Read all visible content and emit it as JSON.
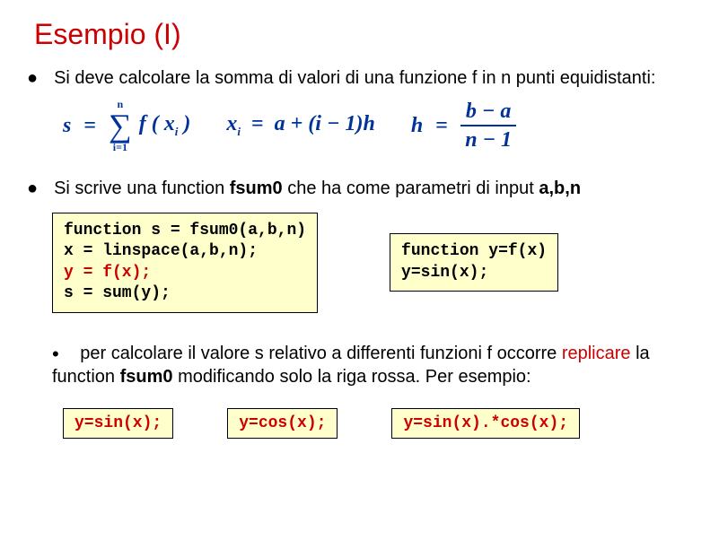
{
  "title": "Esempio (I)",
  "bullet1": "Si deve calcolare la somma di valori di una funzione f in n punti equidistanti:",
  "math": {
    "sum_lhs": "s",
    "sum_top": "n",
    "sum_bot": "i=1",
    "sum_rhs": "f ( x",
    "sum_rhs_sub": "i",
    "sum_rhs_close": " )",
    "x_lhs": "x",
    "x_sub": "i",
    "x_rhs": "a + (i − 1)h",
    "h_lhs": "h",
    "h_num": "b − a",
    "h_den": "n − 1"
  },
  "bullet2_pre": "Si scrive una function ",
  "bullet2_bold": "fsum0",
  "bullet2_mid": " che ha come parametri di input ",
  "bullet2_bold2": "a,b,n",
  "code1": {
    "line1": "function s = fsum0(a,b,n)",
    "line2": "x = linspace(a,b,n);",
    "line3": "y = f(x);",
    "line4": "s = sum(y);"
  },
  "code2": {
    "line1": "function y=f(x)",
    "line2": "y=sin(x);"
  },
  "para_dot": "•",
  "para_pre": "per calcolare il valore s relativo a differenti funzioni f occorre ",
  "para_red": "replicare",
  "para_mid": " la function ",
  "para_bold": "fsum0",
  "para_post": " modificando solo la riga rossa. Per esempio:",
  "examples": [
    "y=sin(x);",
    "y=cos(x);",
    "y=sin(x).*cos(x);"
  ]
}
